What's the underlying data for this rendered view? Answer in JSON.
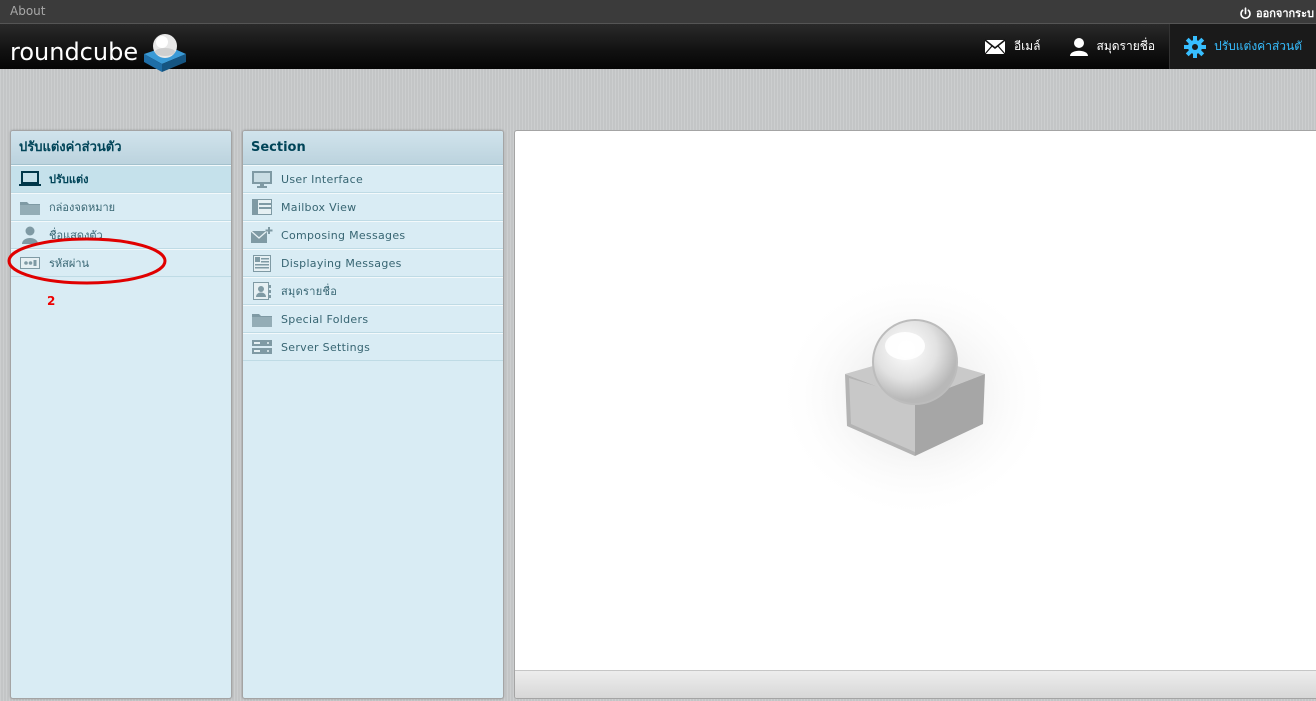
{
  "topline": {
    "about": "About",
    "logout": "ออกจากระบ"
  },
  "header": {
    "logo_text": "roundcube",
    "tasks": [
      {
        "label": "อีเมล์",
        "icon": "mail-icon"
      },
      {
        "label": "สมุดรายชื่อ",
        "icon": "contacts-icon"
      },
      {
        "label": "ปรับแต่งค่าส่วนตั",
        "icon": "settings-icon",
        "selected": true
      }
    ]
  },
  "settings_panel": {
    "title": "ปรับแต่งค่าส่วนตัว",
    "items": [
      {
        "label": "ปรับแต่ง",
        "icon": "monitor-icon",
        "selected": true
      },
      {
        "label": "กล่องจดหมาย",
        "icon": "folder-icon"
      },
      {
        "label": "ชื่อแสดงตัว",
        "icon": "person-icon"
      },
      {
        "label": "รหัสผ่าน",
        "icon": "password-icon"
      }
    ]
  },
  "annotation": {
    "number": "2",
    "color": "#e00000"
  },
  "sections_panel": {
    "title": "Section",
    "items": [
      {
        "label": "User Interface",
        "icon": "monitor-icon"
      },
      {
        "label": "Mailbox View",
        "icon": "mailbox-view-icon"
      },
      {
        "label": "Composing Messages",
        "icon": "compose-icon"
      },
      {
        "label": "Displaying Messages",
        "icon": "display-messages-icon"
      },
      {
        "label": "สมุดรายชื่อ",
        "icon": "addressbook-icon"
      },
      {
        "label": "Special Folders",
        "icon": "folder-icon"
      },
      {
        "label": "Server Settings",
        "icon": "server-icon"
      }
    ]
  },
  "colors": {
    "accent": "#37beff",
    "panel_bg": "#d9ecf4",
    "header_text": "#004458"
  }
}
